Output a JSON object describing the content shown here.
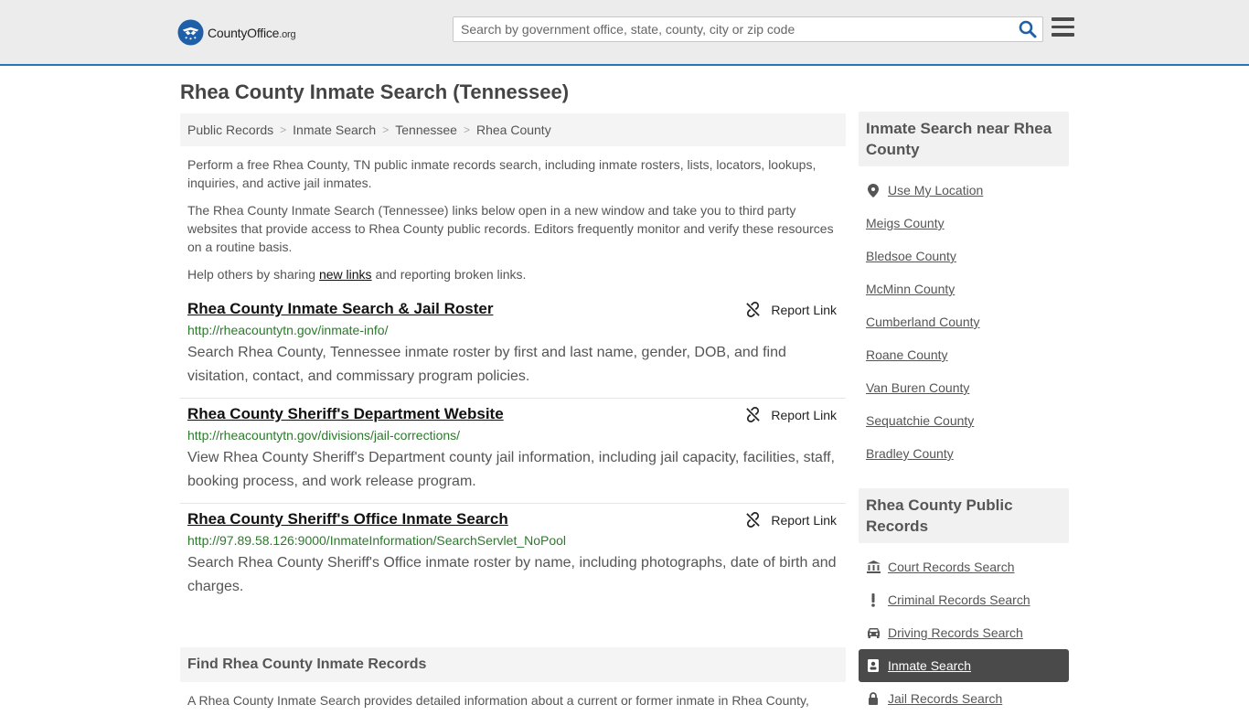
{
  "header": {
    "logo_text": "CountyOffice",
    "logo_tld": ".org",
    "search_placeholder": "Search by government office, state, county, city or zip code",
    "accent_color": "#2a74b9"
  },
  "page": {
    "title": "Rhea County Inmate Search (Tennessee)"
  },
  "breadcrumb": [
    "Public Records",
    "Inmate Search",
    "Tennessee",
    "Rhea County"
  ],
  "intro": {
    "p1": "Perform a free Rhea County, TN public inmate records search, including inmate rosters, lists, locators, lookups, inquiries, and active jail inmates.",
    "p2": "The Rhea County Inmate Search (Tennessee) links below open in a new window and take you to third party websites that provide access to Rhea County public records. Editors frequently monitor and verify these resources on a routine basis.",
    "p3_before": "Help others by sharing ",
    "p3_link": "new links",
    "p3_after": " and reporting broken links."
  },
  "report_label": "Report Link",
  "links": [
    {
      "title": "Rhea County Inmate Search & Jail Roster",
      "url": "http://rheacountytn.gov/inmate-info/",
      "description": "Search Rhea County, Tennessee inmate roster by first and last name, gender, DOB, and find visitation, contact, and commissary program policies."
    },
    {
      "title": "Rhea County Sheriff's Department Website",
      "url": "http://rheacountytn.gov/divisions/jail-corrections/",
      "description": "View Rhea County Sheriff's Department county jail information, including jail capacity, facilities, staff, booking process, and work release program."
    },
    {
      "title": "Rhea County Sheriff's Office Inmate Search",
      "url": "http://97.89.58.126:9000/InmateInformation/SearchServlet_NoPool",
      "description": "Search Rhea County Sheriff's Office inmate roster by name, including photographs, date of birth and charges."
    }
  ],
  "find": {
    "title": "Find Rhea County Inmate Records",
    "text": "A Rhea County Inmate Search provides detailed information about a current or former inmate in Rhea County,"
  },
  "sidebar": {
    "near_title": "Inmate Search near Rhea County",
    "near_items": [
      {
        "label": "Use My Location",
        "icon": "location-pin-icon"
      },
      {
        "label": "Meigs County"
      },
      {
        "label": "Bledsoe County"
      },
      {
        "label": "McMinn County"
      },
      {
        "label": "Cumberland County"
      },
      {
        "label": "Roane County"
      },
      {
        "label": "Van Buren County"
      },
      {
        "label": "Sequatchie County"
      },
      {
        "label": "Bradley County"
      }
    ],
    "records_title": "Rhea County Public Records",
    "records_items": [
      {
        "label": "Court Records Search",
        "icon": "courthouse-icon"
      },
      {
        "label": "Criminal Records Search",
        "icon": "exclamation-icon"
      },
      {
        "label": "Driving Records Search",
        "icon": "car-icon"
      },
      {
        "label": "Inmate Search",
        "icon": "id-badge-icon",
        "active": true
      },
      {
        "label": "Jail Records Search",
        "icon": "lock-icon"
      }
    ]
  }
}
